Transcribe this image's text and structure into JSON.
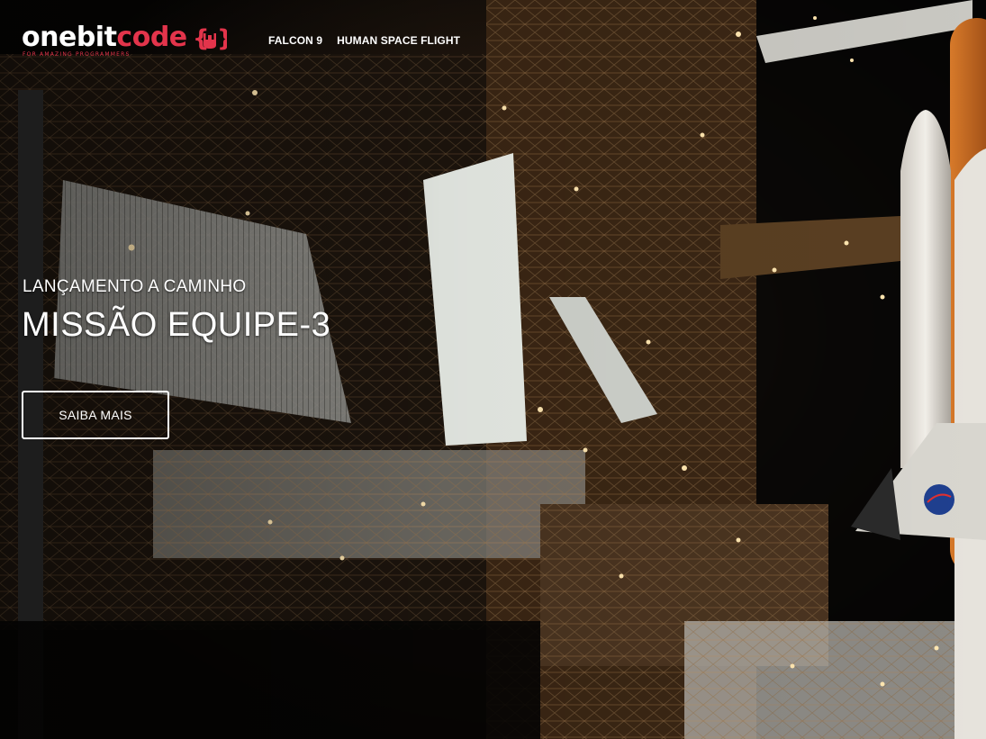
{
  "brand": {
    "logo_prefix": "onebit",
    "logo_suffix": "code",
    "logo_brace_open": "{",
    "logo_brace_close": "}",
    "tagline": "FOR AMAZING PROGRAMMERS",
    "accent_color": "#e3344b"
  },
  "nav": {
    "items": [
      {
        "label": "FALCON 9"
      },
      {
        "label": "HUMAN SPACE FLIGHT"
      }
    ]
  },
  "hero": {
    "kicker": "LANÇAMENTO A CAMINHO",
    "title": "MISSÃO EQUIPE-3",
    "cta_label": "SAIBA MAIS",
    "background_image": "night launch pad with illuminated service structure and space shuttle"
  }
}
